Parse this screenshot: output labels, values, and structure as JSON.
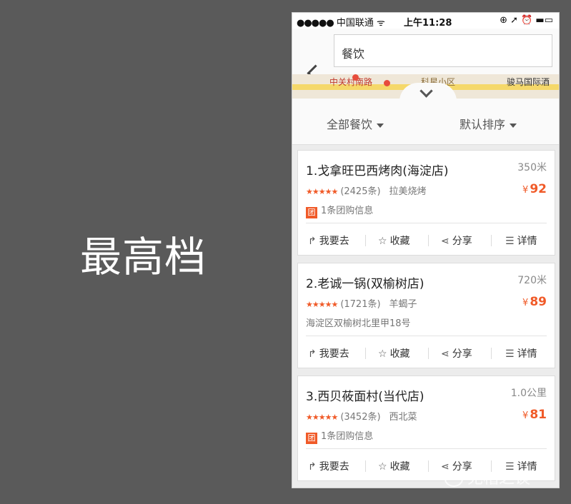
{
  "side_title": "最高档",
  "status": {
    "signal": "●●●●●",
    "carrier": "中国联通",
    "wifi": "ᯤ",
    "time": "上午11:28",
    "right": "⊕ ➚ ⏰ ▬▭"
  },
  "search": {
    "value": "餐饮"
  },
  "map": {
    "label1": "中关村南路",
    "label2": "科星小区",
    "label3": "骏马国际酒"
  },
  "filters": {
    "category": "全部餐饮",
    "sort": "默认排序"
  },
  "actions": {
    "go": "我要去",
    "fav": "收藏",
    "share": "分享",
    "detail": "详情"
  },
  "results": [
    {
      "name": "1.戈拿旺巴西烤肉(海淀店)",
      "distance": "350米",
      "stars": "★★★★★",
      "reviews": "(2425条)",
      "category": "拉美烧烤",
      "price_symbol": "¥",
      "price": "92",
      "tuan": "团",
      "extra": "1条团购信息"
    },
    {
      "name": "2.老诚一锅(双榆树店)",
      "distance": "720米",
      "stars": "★★★★★",
      "reviews": "(1721条)",
      "category": "羊蝎子",
      "price_symbol": "¥",
      "price": "89",
      "extra": "海淀区双榆树北里甲18号"
    },
    {
      "name": "3.西贝莜面村(当代店)",
      "distance": "1.0公里",
      "stars": "★★★★★",
      "reviews": "(3452条)",
      "category": "西北菜",
      "price_symbol": "¥",
      "price": "81",
      "tuan": "团",
      "extra": "1条团购信息"
    }
  ],
  "watermark": "无稽之谈",
  "colors": {
    "accent": "#f05a28",
    "background": "#5a5a5a"
  }
}
